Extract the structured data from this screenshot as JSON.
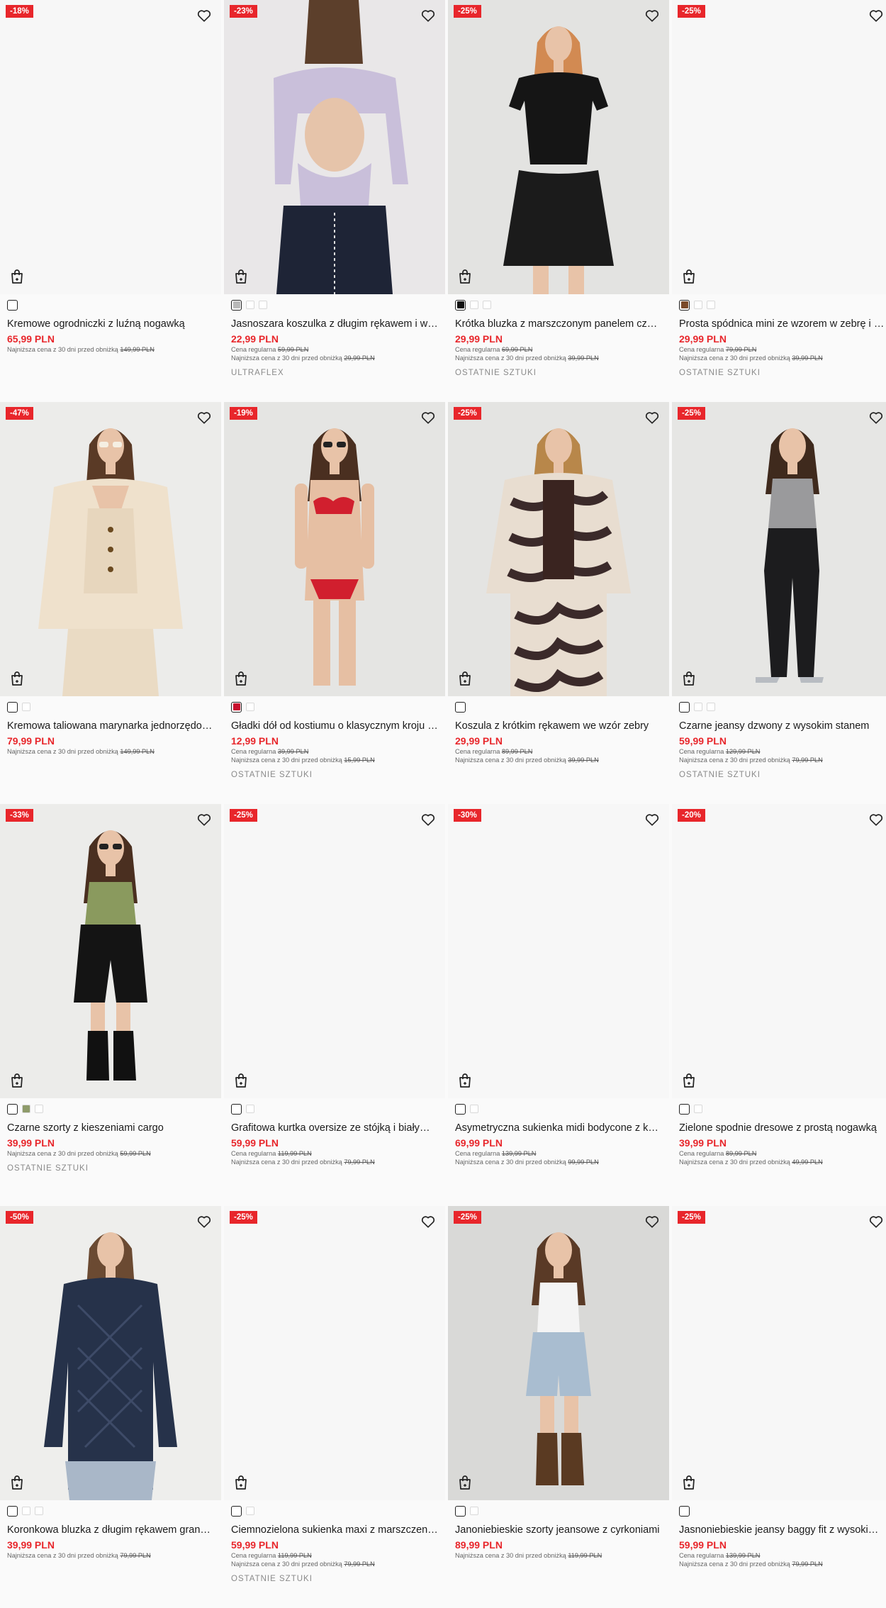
{
  "ui": {
    "regular_price_label": "Cena regularna",
    "lowest_price_label": "Najniższa cena z 30 dni przed obniżką"
  },
  "products": [
    {
      "badge": "-18%",
      "photo": "blank",
      "swatches": [
        {
          "color": "#ffffff"
        }
      ],
      "selected": 0,
      "name": "Kremowe ogrodniczki z luźną nogawką",
      "price": "65,99 PLN",
      "regular": "",
      "lowest": "149,99 PLN",
      "tag": ""
    },
    {
      "badge": "-23%",
      "photo": "lilac-top",
      "swatches": [
        {
          "color": "#b8b8b8"
        },
        {
          "color": "#ffffff"
        },
        {
          "color": "#ffffff"
        }
      ],
      "selected": 0,
      "name": "Jasnoszara koszulka z długim rękawem i wycięciem na plecach",
      "price": "22,99 PLN",
      "regular": "59,99 PLN",
      "lowest": "29,99 PLN",
      "tag": "ULTRAFLEX"
    },
    {
      "badge": "-25%",
      "photo": "black-set",
      "swatches": [
        {
          "color": "#111111"
        },
        {
          "color": "#ffffff"
        },
        {
          "color": "#ffffff"
        }
      ],
      "selected": 0,
      "name": "Krótka bluzka z marszczonym panelem czarna",
      "price": "29,99 PLN",
      "regular": "69,99 PLN",
      "lowest": "39,99 PLN",
      "tag": "OSTATNIE SZTUKI"
    },
    {
      "badge": "-25%",
      "photo": "blank",
      "swatches": [
        {
          "color": "#7a4a2a"
        },
        {
          "color": "#ffffff"
        },
        {
          "color": "#ffffff"
        }
      ],
      "selected": 0,
      "name": "Prosta spódnica mini ze wzorem w zebrę i rozcięciem",
      "price": "29,99 PLN",
      "regular": "79,99 PLN",
      "lowest": "39,99 PLN",
      "tag": "OSTATNIE SZTUKI"
    },
    {
      "badge": "-47%",
      "photo": "blazer",
      "swatches": [
        {
          "color": "#ffffff"
        },
        {
          "color": "#ffffff"
        }
      ],
      "selected": 0,
      "name": "Kremowa taliowana marynarka jednorzędowa",
      "price": "79,99 PLN",
      "regular": "",
      "lowest": "149,99 PLN",
      "tag": ""
    },
    {
      "badge": "-19%",
      "photo": "bikini",
      "swatches": [
        {
          "color": "#c8102e"
        },
        {
          "color": "#ffffff"
        }
      ],
      "selected": 0,
      "name": "Gładki dół od kostiumu o klasycznym kroju czerwony",
      "price": "12,99 PLN",
      "regular": "39,99 PLN",
      "lowest": "15,99 PLN",
      "tag": "OSTATNIE SZTUKI"
    },
    {
      "badge": "-25%",
      "photo": "zebra-shirt",
      "swatches": [
        {
          "color": "#ffffff"
        }
      ],
      "selected": 0,
      "name": "Koszula z krótkim rękawem we wzór zebry",
      "price": "29,99 PLN",
      "regular": "89,99 PLN",
      "lowest": "39,99 PLN",
      "tag": ""
    },
    {
      "badge": "-25%",
      "photo": "flare-jeans",
      "swatches": [
        {
          "color": "#ffffff"
        },
        {
          "color": "#ffffff"
        },
        {
          "color": "#ffffff"
        }
      ],
      "selected": 0,
      "name": "Czarne jeansy dzwony z wysokim stanem",
      "price": "59,99 PLN",
      "regular": "129,99 PLN",
      "lowest": "79,99 PLN",
      "tag": "OSTATNIE SZTUKI"
    },
    {
      "badge": "-33%",
      "photo": "cargo-shorts",
      "swatches": [
        {
          "color": "#ffffff"
        },
        {
          "color": "#8e9b6a"
        },
        {
          "color": "#ffffff"
        }
      ],
      "selected": 0,
      "name": "Czarne szorty z kieszeniami cargo",
      "price": "39,99 PLN",
      "regular": "",
      "lowest": "59,99 PLN",
      "tag": "OSTATNIE SZTUKI"
    },
    {
      "badge": "-25%",
      "photo": "blank",
      "swatches": [
        {
          "color": "#ffffff"
        },
        {
          "color": "#ffffff"
        }
      ],
      "selected": 0,
      "name": "Grafitowa kurtka oversize ze stójką i białymi wstawkami",
      "price": "59,99 PLN",
      "regular": "119,99 PLN",
      "lowest": "79,99 PLN",
      "tag": ""
    },
    {
      "badge": "-30%",
      "photo": "blank",
      "swatches": [
        {
          "color": "#ffffff"
        },
        {
          "color": "#ffffff"
        }
      ],
      "selected": 0,
      "name": "Asymetryczna sukienka midi bodycone z kokardą",
      "price": "69,99 PLN",
      "regular": "139,99 PLN",
      "lowest": "99,99 PLN",
      "tag": ""
    },
    {
      "badge": "-20%",
      "photo": "blank",
      "swatches": [
        {
          "color": "#ffffff"
        },
        {
          "color": "#ffffff"
        }
      ],
      "selected": 0,
      "name": "Zielone spodnie dresowe z prostą nogawką",
      "price": "39,99 PLN",
      "regular": "89,99 PLN",
      "lowest": "49,99 PLN",
      "tag": ""
    },
    {
      "badge": "-50%",
      "photo": "lace-top",
      "swatches": [
        {
          "color": "#ffffff"
        },
        {
          "color": "#ffffff"
        },
        {
          "color": "#ffffff"
        }
      ],
      "selected": 0,
      "name": "Koronkowa bluzka z długim rękawem granatowa",
      "price": "39,99 PLN",
      "regular": "",
      "lowest": "79,99 PLN",
      "tag": ""
    },
    {
      "badge": "-25%",
      "photo": "blank",
      "swatches": [
        {
          "color": "#ffffff"
        },
        {
          "color": "#ffffff"
        }
      ],
      "selected": 0,
      "name": "Ciemnozielona sukienka maxi z marszczeniami",
      "price": "59,99 PLN",
      "regular": "119,99 PLN",
      "lowest": "79,99 PLN",
      "tag": "OSTATNIE SZTUKI"
    },
    {
      "badge": "-25%",
      "photo": "denim-shorts",
      "swatches": [
        {
          "color": "#ffffff"
        },
        {
          "color": "#ffffff"
        }
      ],
      "selected": 0,
      "name": "Janoniebieskie szorty jeansowe z cyrkoniami",
      "price": "89,99 PLN",
      "regular": "",
      "lowest": "119,99 PLN",
      "tag": ""
    },
    {
      "badge": "-25%",
      "photo": "blank",
      "swatches": [
        {
          "color": "#ffffff"
        }
      ],
      "selected": 0,
      "name": "Jasnoniebieskie jeansy baggy fit z wysokim stanem",
      "price": "59,99 PLN",
      "regular": "139,99 PLN",
      "lowest": "79,99 PLN",
      "tag": ""
    }
  ]
}
